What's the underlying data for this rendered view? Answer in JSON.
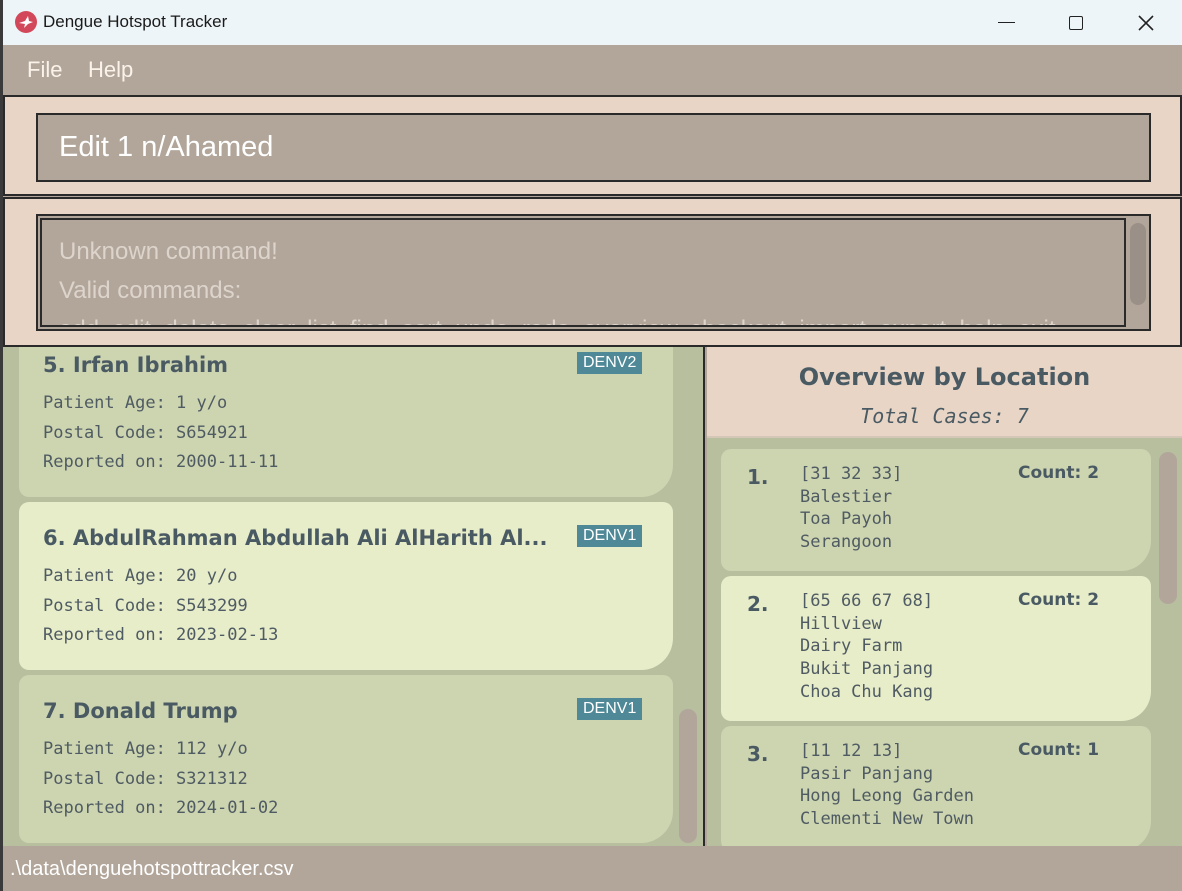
{
  "window": {
    "title": "Dengue Hotspot Tracker",
    "icon": "app-logo-icon",
    "accent": "#d2485a"
  },
  "menu": {
    "file": "File",
    "help": "Help"
  },
  "command": {
    "value": "Edit 1 n/Ahamed"
  },
  "result": {
    "lines": [
      "Unknown command!",
      "Valid commands:",
      "add, edit, delete, clear, list, find, sort, undo, redo, overview, checkout, import, export, help, exit"
    ]
  },
  "patients": [
    {
      "name": "5. Irfan Ibrahim",
      "tag": "DENV2",
      "age": "Patient Age: 1 y/o",
      "postal": "Postal Code: S654921",
      "date": "Reported on: 2000-11-11"
    },
    {
      "name": "6. AbdulRahman Abdullah Ali AlHarith Al...",
      "tag": "DENV1",
      "age": "Patient Age: 20 y/o",
      "postal": "Postal Code: S543299",
      "date": "Reported on: 2023-02-13"
    },
    {
      "name": "7. Donald Trump",
      "tag": "DENV1",
      "age": "Patient Age: 112 y/o",
      "postal": "Postal Code: S321312",
      "date": "Reported on: 2024-01-02"
    }
  ],
  "overview": {
    "title": "Overview by Location",
    "total": "Total Cases: 7",
    "items": [
      {
        "index": "1.",
        "lines": [
          "[31 32 33]",
          "Balestier",
          "Toa Payoh",
          "Serangoon"
        ],
        "count": "Count: 2"
      },
      {
        "index": "2.",
        "lines": [
          "[65 66 67 68]",
          "Hillview",
          "Dairy Farm",
          "Bukit Panjang",
          "Choa Chu Kang"
        ],
        "count": "Count: 2"
      },
      {
        "index": "3.",
        "lines": [
          "[11 12 13]",
          "Pasir Panjang",
          "Hong Leong Garden",
          "Clementi New Town"
        ],
        "count": "Count: 1"
      }
    ]
  },
  "status": {
    "path": ".\\data\\denguehotspottracker.csv"
  }
}
